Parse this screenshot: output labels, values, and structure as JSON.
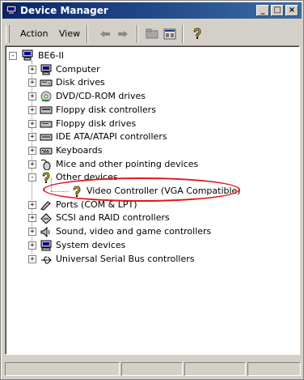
{
  "window": {
    "title": "Device Manager"
  },
  "menu": {
    "action": "Action",
    "view": "View"
  },
  "tree": {
    "root": "BE6-II",
    "items": [
      {
        "label": "Computer",
        "expander": "+"
      },
      {
        "label": "Disk drives",
        "expander": "+"
      },
      {
        "label": "DVD/CD-ROM drives",
        "expander": "+"
      },
      {
        "label": "Floppy disk controllers",
        "expander": "+"
      },
      {
        "label": "Floppy disk drives",
        "expander": "+"
      },
      {
        "label": "IDE ATA/ATAPI controllers",
        "expander": "+"
      },
      {
        "label": "Keyboards",
        "expander": "+"
      },
      {
        "label": "Mice and other pointing devices",
        "expander": "+"
      },
      {
        "label": "Other devices",
        "expander": "-"
      },
      {
        "label": "Video Controller (VGA Compatible)",
        "expander": ""
      },
      {
        "label": "Ports (COM & LPT)",
        "expander": "+"
      },
      {
        "label": "SCSI and RAID controllers",
        "expander": "+"
      },
      {
        "label": "Sound, video and game controllers",
        "expander": "+"
      },
      {
        "label": "System devices",
        "expander": "+"
      },
      {
        "label": "Universal Serial Bus controllers",
        "expander": "+"
      }
    ]
  },
  "colors": {
    "title_start": "#0a246a",
    "title_end": "#3a6ea5",
    "highlight_ellipse": "#e0161a",
    "warning": "#f5d800"
  }
}
